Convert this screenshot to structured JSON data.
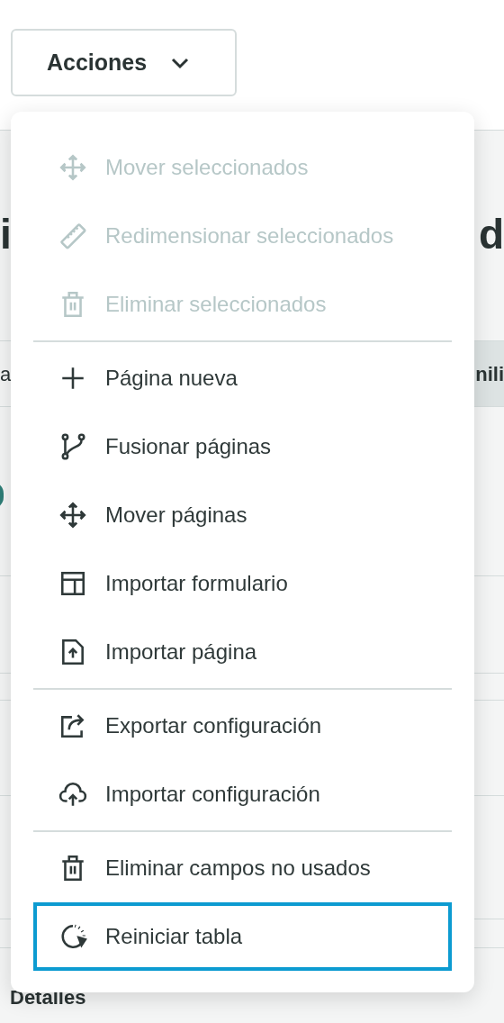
{
  "actions_button": {
    "label": "Acciones"
  },
  "background": {
    "heading_left": "i",
    "heading_right": "d",
    "column_left": "a",
    "column_right": "nili",
    "section": "Detalles"
  },
  "menu": {
    "groups": [
      [
        {
          "kind": "move",
          "label": "Mover seleccionados",
          "disabled": true,
          "focused": false
        },
        {
          "kind": "ruler",
          "label": "Redimensionar seleccionados",
          "disabled": true,
          "focused": false
        },
        {
          "kind": "trash",
          "label": "Eliminar seleccionados",
          "disabled": true,
          "focused": false
        }
      ],
      [
        {
          "kind": "plus",
          "label": "Página nueva",
          "disabled": false,
          "focused": false
        },
        {
          "kind": "branch",
          "label": "Fusionar páginas",
          "disabled": false,
          "focused": false
        },
        {
          "kind": "move",
          "label": "Mover páginas",
          "disabled": false,
          "focused": false
        },
        {
          "kind": "layout",
          "label": "Importar formulario",
          "disabled": false,
          "focused": false
        },
        {
          "kind": "file-upload",
          "label": "Importar página",
          "disabled": false,
          "focused": false
        }
      ],
      [
        {
          "kind": "export",
          "label": "Exportar configuración",
          "disabled": false,
          "focused": false
        },
        {
          "kind": "cloud-upload",
          "label": "Importar configuración",
          "disabled": false,
          "focused": false
        }
      ],
      [
        {
          "kind": "trash",
          "label": "Eliminar campos no usados",
          "disabled": false,
          "focused": false
        },
        {
          "kind": "reset",
          "label": "Reiniciar tabla",
          "disabled": false,
          "focused": true
        }
      ]
    ]
  }
}
